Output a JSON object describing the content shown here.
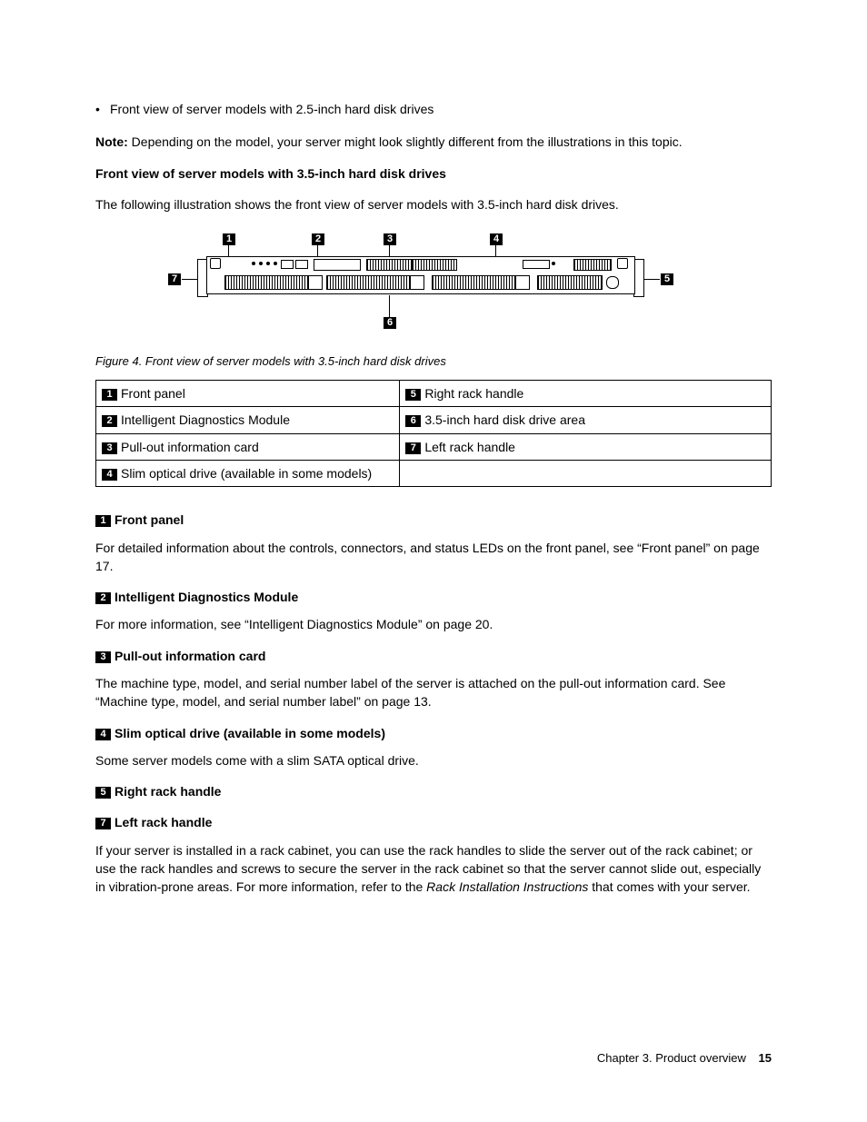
{
  "intro": {
    "bullet": "Front view of server models with 2.5-inch hard disk drives",
    "note_label": "Note:",
    "note_text": "Depending on the model, your server might look slightly different from the illustrations in this topic.",
    "heading": "Front view of server models with 3.5-inch hard disk drives",
    "lead": "The following illustration shows the front view of server models with 3.5-inch hard disk drives."
  },
  "figure": {
    "callouts": {
      "n1": "1",
      "n2": "2",
      "n3": "3",
      "n4": "4",
      "n5": "5",
      "n6": "6",
      "n7": "7"
    },
    "caption": "Figure 4.  Front view of server models with 3.5-inch hard disk drives"
  },
  "table": {
    "rows": [
      {
        "ln": "1",
        "lt": "Front panel",
        "rn": "5",
        "rt": "Right rack handle"
      },
      {
        "ln": "2",
        "lt": "Intelligent Diagnostics Module",
        "rn": "6",
        "rt": "3.5-inch hard disk drive area"
      },
      {
        "ln": "3",
        "lt": "Pull-out information card",
        "rn": "7",
        "rt": "Left rack handle"
      },
      {
        "ln": "4",
        "lt": "Slim optical drive (available in some models)",
        "rn": "",
        "rt": ""
      }
    ]
  },
  "details": {
    "i1": {
      "num": "1",
      "title": "Front panel",
      "body": "For detailed information about the controls, connectors, and status LEDs on the front panel, see “Front panel” on page 17."
    },
    "i2": {
      "num": "2",
      "title": "Intelligent Diagnostics Module",
      "body": "For more information, see “Intelligent Diagnostics Module” on page 20."
    },
    "i3": {
      "num": "3",
      "title": "Pull-out information card",
      "body": "The machine type, model, and serial number label of the server is attached on the pull-out information card. See “Machine type, model, and serial number label” on page 13."
    },
    "i4": {
      "num": "4",
      "title": "Slim optical drive (available in some models)",
      "body": "Some server models come with a slim SATA optical drive."
    },
    "i5": {
      "num": "5",
      "title": "Right rack handle"
    },
    "i7": {
      "num": "7",
      "title": "Left rack handle",
      "body_a": "If your server is installed in a rack cabinet, you can use the rack handles to slide the server out of the rack cabinet; or use the rack handles and screws to secure the server in the rack cabinet so that the server cannot slide out, especially in vibration-prone areas. For more information, refer to the ",
      "body_italic": "Rack Installation Instructions",
      "body_b": " that comes with your server."
    }
  },
  "footer": {
    "chapter": "Chapter 3.  Product overview",
    "page": "15"
  }
}
